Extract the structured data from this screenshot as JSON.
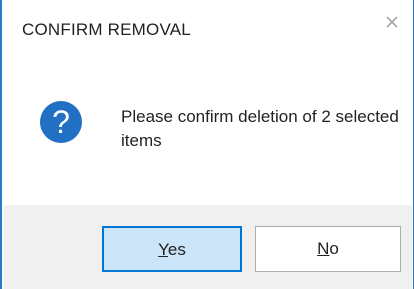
{
  "dialog": {
    "title": "CONFIRM REMOVAL",
    "close_icon": "close-icon",
    "message_icon": "question-icon",
    "message_icon_glyph": "?",
    "message": "Please confirm deletion of 2 selected items",
    "buttons": {
      "yes": {
        "accesskey": "Y",
        "rest": "es"
      },
      "no": {
        "accesskey": "N",
        "rest": "o"
      }
    }
  },
  "colors": {
    "window_border": "#2b79c8",
    "icon_blue": "#2170c4",
    "default_button_bg": "#cce4f7",
    "default_button_border": "#0078d7",
    "footer_bg": "#f0f0f0"
  }
}
